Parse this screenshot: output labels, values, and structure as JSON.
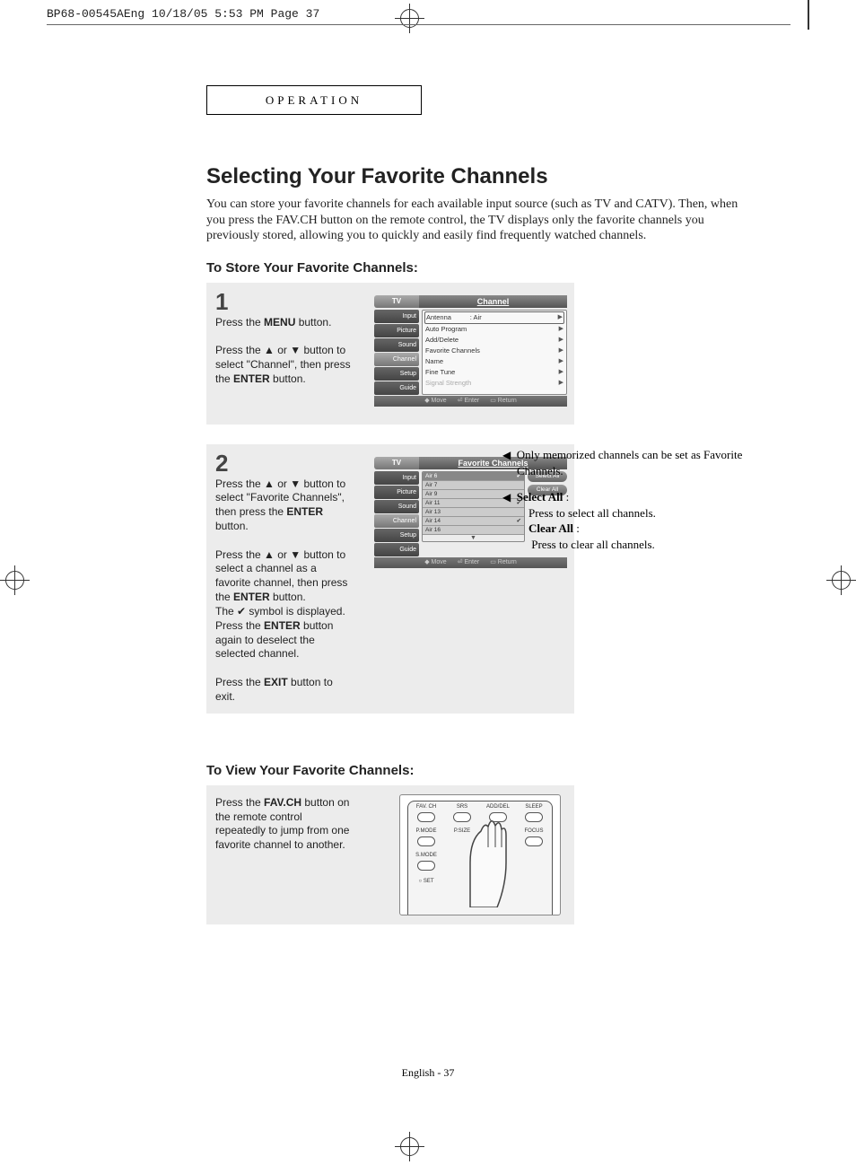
{
  "crop_header": "BP68-00545AEng  10/18/05  5:53 PM  Page 37",
  "section_label": "OPERATION",
  "title": "Selecting Your Favorite Channels",
  "intro": "You can store your favorite channels for each available input source (such as TV and CATV). Then, when you press the FAV.CH button on the remote control, the TV displays only the favorite channels you previously stored, allowing you to quickly and easily find frequently watched channels.",
  "store_heading": "To Store Your Favorite Channels:",
  "view_heading": "To View Your Favorite Channels:",
  "step1": {
    "num": "1",
    "line1_a": "Press the ",
    "line1_b": "MENU",
    "line1_c": " button.",
    "line2_a": "Press the  ▲ or ▼  button to select \"Channel\", then press the ",
    "line2_b": "ENTER",
    "line2_c": " button."
  },
  "step2": {
    "num": "2",
    "p1_a": "Press the ▲ or ▼ button to select \"Favorite Channels\", then press the ",
    "p1_b": "ENTER",
    "p1_c": " button.",
    "p2_a": "Press the ▲ or ▼ button to select  a channel as a favorite channel, then press the ",
    "p2_b": "ENTER",
    "p2_c": " button.",
    "p3": "The ✔ symbol is displayed.",
    "p4_a": "Press the ",
    "p4_b": "ENTER",
    "p4_c": " button again to deselect the selected channel.",
    "p5_a": "Press the ",
    "p5_b": "EXIT",
    "p5_c": " button to exit."
  },
  "step3": {
    "p_a": "Press the ",
    "p_b": "FAV.CH",
    "p_c": " button on the remote control repeatedly to jump from one favorite channel to another."
  },
  "osd1": {
    "tl": "TV",
    "tr": "Channel",
    "tabs": [
      "Input",
      "Picture",
      "Sound",
      "Channel",
      "Setup",
      "Guide"
    ],
    "antenna_label": "Antenna",
    "antenna_value": ": Air",
    "items": [
      "Auto Program",
      "Add/Delete",
      "Favorite Channels",
      "Name",
      "Fine Tune",
      "Signal Strength"
    ],
    "foot_move": "Move",
    "foot_enter": "Enter",
    "foot_return": "Return"
  },
  "osd2": {
    "tl": "TV",
    "tr": "Favorite Channels",
    "tabs": [
      "Input",
      "Picture",
      "Sound",
      "Channel",
      "Setup",
      "Guide"
    ],
    "rows": [
      {
        "name": "Air 6",
        "check": true,
        "sel": true
      },
      {
        "name": "Air 7"
      },
      {
        "name": "Air 9"
      },
      {
        "name": "Air 11",
        "check": true
      },
      {
        "name": "Air 13"
      },
      {
        "name": "Air 14",
        "check": true
      },
      {
        "name": "Air 16"
      }
    ],
    "btn_select": "Select All",
    "btn_clear": "Clear All",
    "foot_move": "Move",
    "foot_enter": "Enter",
    "foot_return": "Return"
  },
  "notes": {
    "n1": "Only memorized channels can be set as Favorite Channels.",
    "n2_label": "Select All",
    "n2_text": "Press to select all channels.",
    "n3_label": "Clear All",
    "n3_text": "Press to clear all channels."
  },
  "remote_labels": {
    "favch": "FAV. CH",
    "srs": "SRS",
    "adddel": "ADD/DEL",
    "sleep": "SLEEP",
    "pmode": "P.MODE",
    "psize": "P.SIZE",
    "focus": "FOCUS",
    "smode": "S.MODE",
    "set": "SET"
  },
  "footer": "English - 37"
}
